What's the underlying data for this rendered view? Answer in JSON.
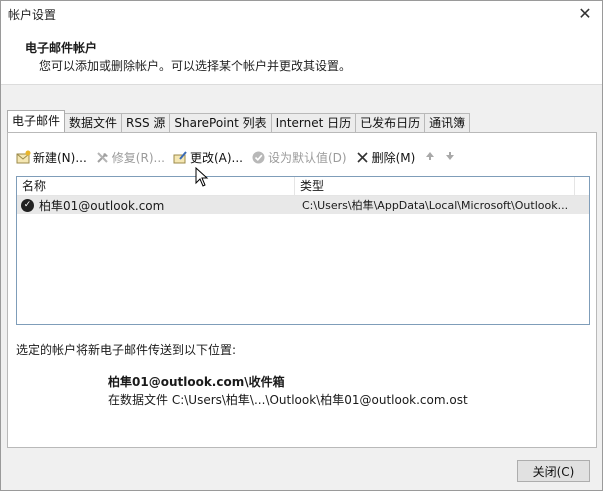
{
  "window": {
    "title": "帐户设置",
    "close_glyph": "✕"
  },
  "header": {
    "title": "电子邮件帐户",
    "description": "您可以添加或删除帐户。可以选择某个帐户并更改其设置。"
  },
  "tabs": [
    {
      "label": "电子邮件",
      "active": true
    },
    {
      "label": "数据文件",
      "active": false
    },
    {
      "label": "RSS 源",
      "active": false
    },
    {
      "label": "SharePoint 列表",
      "active": false
    },
    {
      "label": "Internet 日历",
      "active": false
    },
    {
      "label": "已发布日历",
      "active": false
    },
    {
      "label": "通讯簿",
      "active": false
    }
  ],
  "toolbar": {
    "new_label": "新建(N)...",
    "repair_label": "修复(R)...",
    "change_label": "更改(A)...",
    "default_label": "设为默认值(D)",
    "remove_label": "删除(M)"
  },
  "list": {
    "col_name": "名称",
    "col_type": "类型",
    "rows": [
      {
        "name": "柏隼01@outlook.com",
        "type": "C:\\Users\\柏隼\\AppData\\Local\\Microsoft\\Outlook..."
      }
    ]
  },
  "delivery": {
    "label": "选定的帐户将新电子邮件传送到以下位置:",
    "folder": "柏隼01@outlook.com\\收件箱",
    "path": "在数据文件  C:\\Users\\柏隼\\...\\Outlook\\柏隼01@outlook.com.ost"
  },
  "footer": {
    "close_label": "关闭(C)"
  },
  "colors": {
    "selected_row": "#e8e8e8",
    "panel_bg": "#ffffff",
    "window_bg": "#f0f0f0"
  }
}
